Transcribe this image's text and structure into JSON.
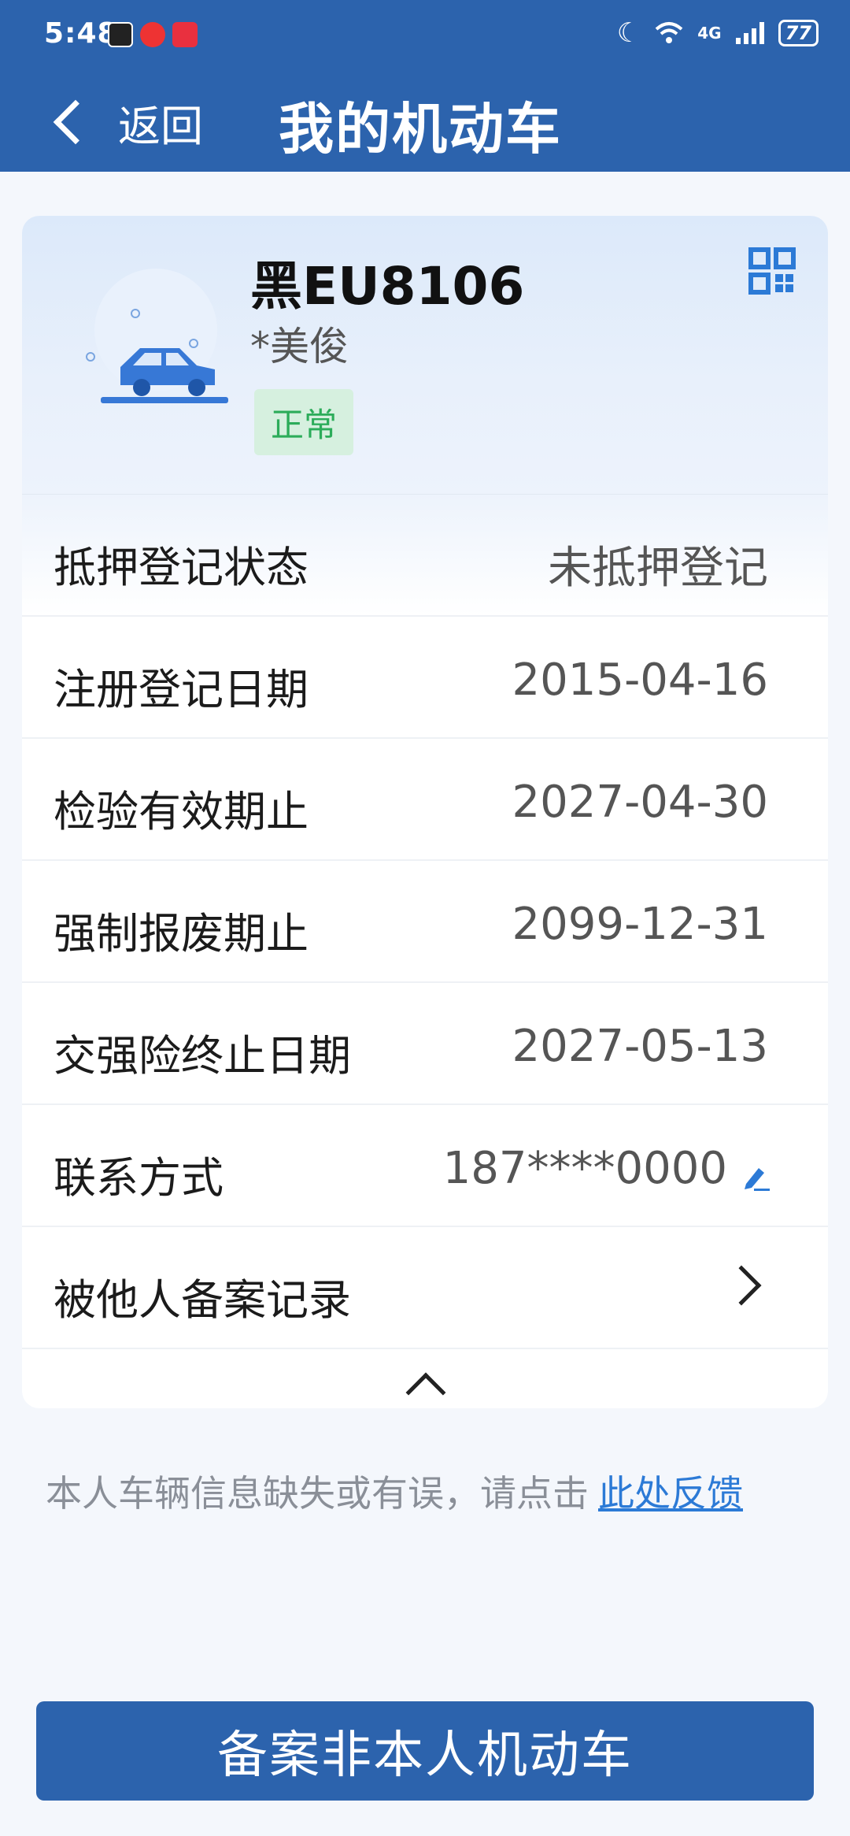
{
  "status_bar": {
    "time": "5:48",
    "network": "4G",
    "battery": "77"
  },
  "header": {
    "back_label": "返回",
    "title": "我的机动车"
  },
  "vehicle": {
    "plate": "黑EU8106",
    "owner": "*美俊",
    "status": "正常",
    "status_color": "#2cac5a"
  },
  "details": [
    {
      "label": "抵押登记状态",
      "value": "未抵押登记"
    },
    {
      "label": "注册登记日期",
      "value": "2015-04-16"
    },
    {
      "label": "检验有效期止",
      "value": "2027-04-30"
    },
    {
      "label": "强制报废期止",
      "value": "2099-12-31"
    },
    {
      "label": "交强险终止日期",
      "value": "2027-05-13"
    },
    {
      "label": "联系方式",
      "value": "187****0000"
    },
    {
      "label": "被他人备案记录",
      "value": ""
    }
  ],
  "feedback": {
    "text": "本人车辆信息缺失或有误，请点击",
    "link": "此处反馈"
  },
  "actions": {
    "primary": "备案非本人机动车"
  },
  "colors": {
    "brand": "#2c63ad",
    "link": "#2c7ad6"
  }
}
